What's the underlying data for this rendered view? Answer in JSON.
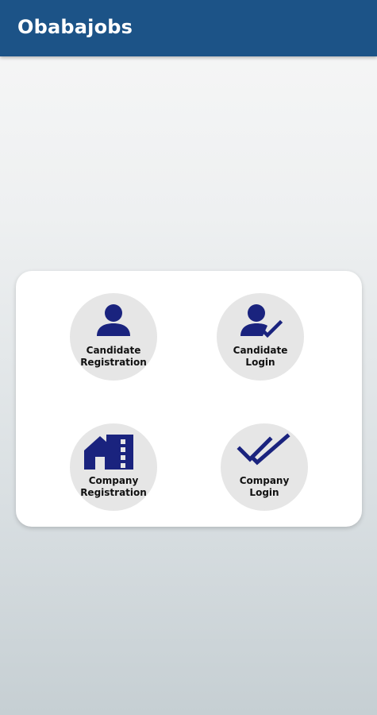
{
  "app_bar": {
    "title": "Obabajobs"
  },
  "tiles": [
    {
      "line1": "Candidate",
      "line2": "Registration",
      "icon": "person-icon"
    },
    {
      "line1": "Candidate",
      "line2": "Login",
      "icon": "person-check-icon"
    },
    {
      "line1": "Company",
      "line2": "Registration",
      "icon": "building-icon"
    },
    {
      "line1": "Company",
      "line2": "Login",
      "icon": "double-check-icon"
    }
  ],
  "colors": {
    "app_bar": "#1c5387",
    "icon": "#1a237e",
    "tile_bg": "#e6e6e6"
  }
}
